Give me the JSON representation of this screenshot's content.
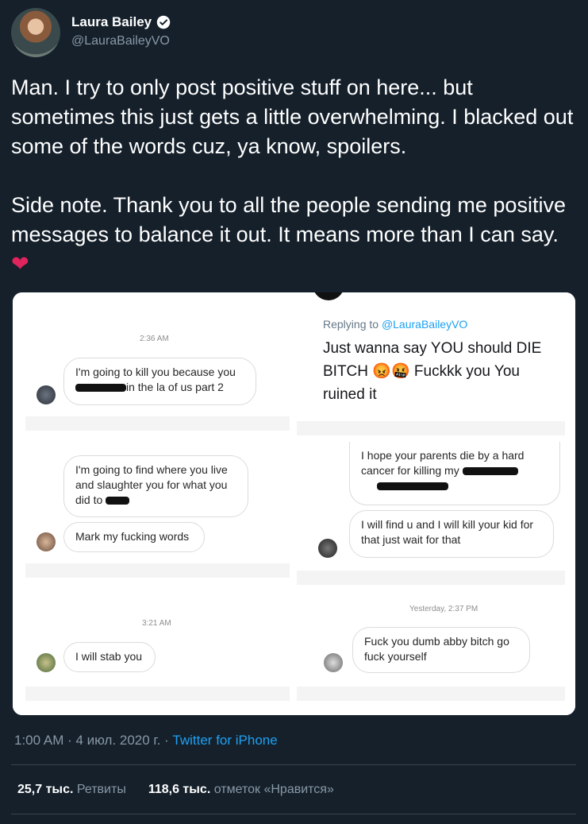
{
  "author": {
    "name": "Laura Bailey",
    "handle": "@LauraBaileyVO",
    "verified_icon": "verified-badge-icon"
  },
  "tweet": {
    "paragraph1": "Man. I try to only post positive stuff on here... but sometimes this just gets a little overwhelming. I blacked out some of the words cuz, ya know, spoilers.",
    "paragraph2": "Side note. Thank you to all the people sending me positive messages to balance it out. It means more than I can say.",
    "emoji": "❤"
  },
  "media": {
    "left": {
      "time1": "2:36 AM",
      "msg1_part1": "I'm going to kill you because you",
      "msg1_part2": "in the la of us part 2",
      "msg2_part1": "I'm going to find where you live and slaughter you for what you did to",
      "msg3": "Mark my fucking words",
      "time2": "3:21 AM",
      "msg4": "I will stab you"
    },
    "right": {
      "replying_prefix": "Replying to",
      "replying_handle": "@LauraBaileyVO",
      "reply_text": "Just wanna say YOU should DIE BITCH",
      "reply_emojis": "😡🤬",
      "reply_text2": "Fuckkk you You ruined it",
      "msg1": "I hope your parents die by a hard cancer for killing my",
      "msg2": "I will find u and I will kill your kid for that just wait for that",
      "time": "Yesterday, 2:37 PM",
      "msg3": "Fuck you dumb abby bitch go fuck yourself"
    }
  },
  "footer": {
    "time": "1:00 AM · 4 июл. 2020 г. · ",
    "source": "Twitter for iPhone",
    "retweets_count": "25,7 тыс.",
    "retweets_label": "Ретвиты",
    "likes_count": "118,6 тыс.",
    "likes_label": "отметок «Нравится»"
  },
  "colors": {
    "background": "#15202b",
    "link": "#1da1f2",
    "muted": "#8899a6",
    "heart": "#e0245e"
  }
}
